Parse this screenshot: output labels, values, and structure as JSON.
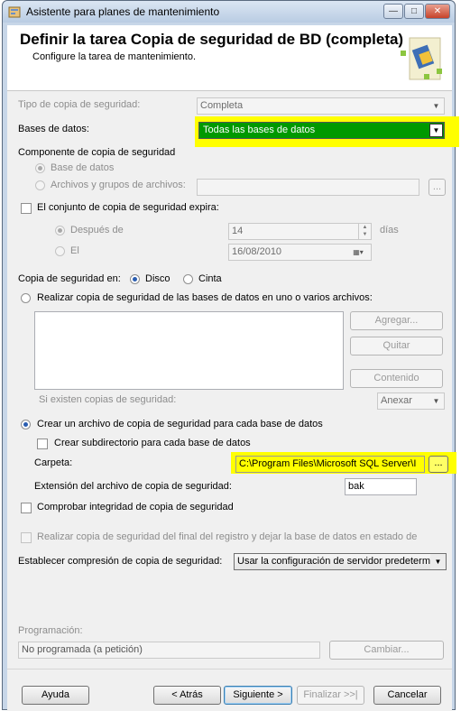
{
  "window": {
    "title": "Asistente para planes de mantenimiento",
    "minimize": "—",
    "maximize": "□",
    "close": "✕"
  },
  "header": {
    "title": "Definir la tarea Copia de seguridad de BD (completa)",
    "subtitle": "Configure la tarea de mantenimiento."
  },
  "form": {
    "backup_type_label": "Tipo de copia de seguridad:",
    "backup_type_value": "Completa",
    "databases_label": "Bases de datos:",
    "databases_value": "Todas las bases de datos",
    "component_label": "Componente de copia de seguridad",
    "component_database": "Base de datos",
    "component_files": "Archivos y grupos de archivos:",
    "expire_label": "El conjunto de copia de seguridad expira:",
    "after_label": "Después de",
    "after_value": "14",
    "days_label": "días",
    "on_label": "El",
    "on_value": "16/08/2010",
    "backup_to_label": "Copia de seguridad en:",
    "disk_label": "Disco",
    "tape_label": "Cinta",
    "multi_files_label": "Realizar copia de seguridad de las bases de datos en uno o varios archivos:",
    "add_button": "Agregar...",
    "remove_button": "Quitar",
    "contents_button": "Contenido",
    "if_exists_label": "Si existen copias de seguridad:",
    "if_exists_value": "Anexar",
    "per_db_label": "Crear un archivo de copia de seguridad para cada base de datos",
    "subdir_label": "Crear subdirectorio para cada base de datos",
    "folder_label": "Carpeta:",
    "folder_value": "C:\\Program Files\\Microsoft SQL Server\\I",
    "browse_button": "...",
    "extension_label": "Extensión del archivo de copia de seguridad:",
    "extension_value": "bak",
    "verify_label": "Comprobar integridad de copia de seguridad",
    "tail_log_label": "Realizar copia de seguridad del final del registro y dejar la base de datos en estado de",
    "compression_label": "Establecer compresión de copia de seguridad:",
    "compression_value": "Usar la configuración de servidor predeterm",
    "schedule_label": "Programación:",
    "schedule_value": "No programada (a petición)",
    "change_button": "Cambiar..."
  },
  "footer": {
    "help": "Ayuda",
    "back": "< Atrás",
    "next": "Siguiente >",
    "finish": "Finalizar >>|",
    "cancel": "Cancelar"
  },
  "colors": {
    "highlight": "#ffff00",
    "selected_db": "#009900"
  }
}
